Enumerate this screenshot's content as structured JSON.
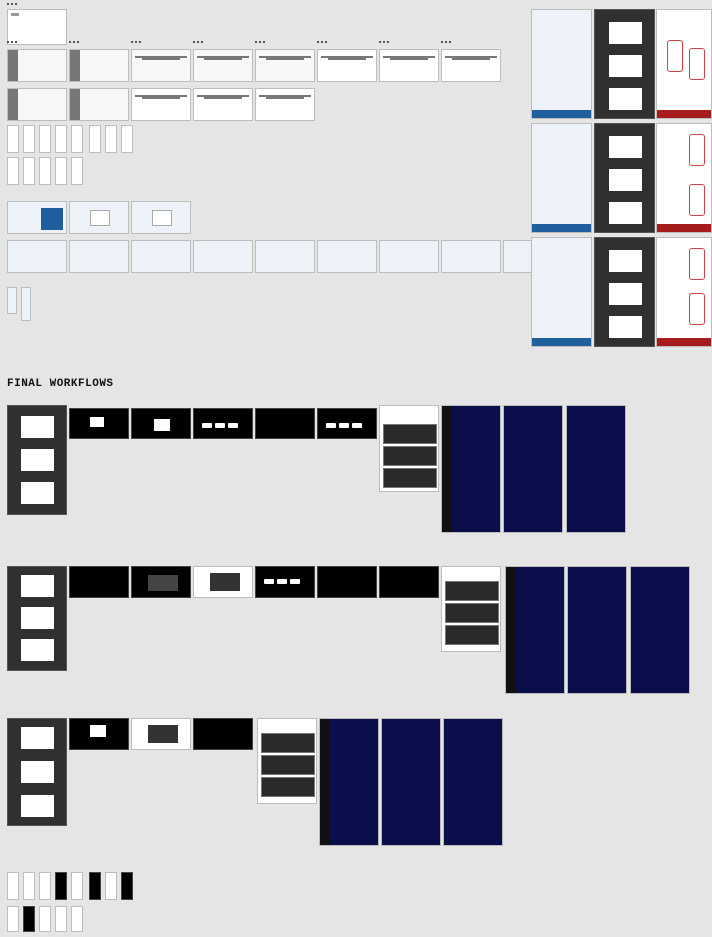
{
  "section_heading": "FINAL WORKFLOWS",
  "artboard_label": "■■■",
  "colors": {
    "canvas": "#e5e5e5",
    "wireframe": "#f7f7f7",
    "blue_wireframe": "#edf2f8",
    "accent_blue": "#1f5f9e",
    "accent_red": "#a61c1c",
    "dark": "#000000",
    "navy": "#0a0f4c",
    "charcoal": "#303030"
  }
}
